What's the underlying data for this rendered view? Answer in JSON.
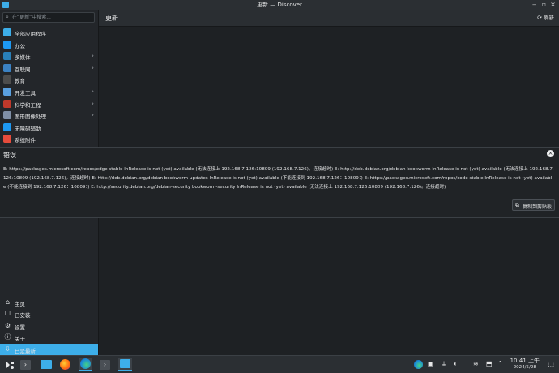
{
  "window": {
    "title": "更新 — Discover"
  },
  "search": {
    "placeholder": "在“更新”中搜索..."
  },
  "categories": [
    {
      "label": "全部应用程序",
      "icon": "all-apps-icon",
      "color": "#3daee9",
      "expandable": false
    },
    {
      "label": "办公",
      "icon": "office-icon",
      "color": "#1d99f3",
      "expandable": false
    },
    {
      "label": "多媒体",
      "icon": "multimedia-icon",
      "color": "#2980b9",
      "expandable": true
    },
    {
      "label": "互联网",
      "icon": "internet-icon",
      "color": "#3b82c4",
      "expandable": true
    },
    {
      "label": "教育",
      "icon": "education-icon",
      "color": "#4d4d4d",
      "expandable": false
    },
    {
      "label": "开发工具",
      "icon": "dev-tools-icon",
      "color": "#5aa0e0",
      "expandable": true
    },
    {
      "label": "科学和工程",
      "icon": "science-icon",
      "color": "#c0392b",
      "expandable": true
    },
    {
      "label": "图形图像处理",
      "icon": "graphics-icon",
      "color": "#7f8fa6",
      "expandable": true
    },
    {
      "label": "无障碍辅助",
      "icon": "accessibility-icon",
      "color": "#1d99f3",
      "expandable": false
    },
    {
      "label": "系统附件",
      "icon": "system-accessories-icon",
      "color": "#e74c3c",
      "expandable": false
    }
  ],
  "bottom_nav": [
    {
      "label": "主页",
      "icon": "home-icon",
      "glyph": "⌂",
      "active": false
    },
    {
      "label": "已安装",
      "icon": "installed-icon",
      "glyph": "☐",
      "active": false
    },
    {
      "label": "设置",
      "icon": "settings-icon",
      "glyph": "⚙",
      "active": false
    },
    {
      "label": "关于",
      "icon": "about-icon",
      "glyph": "ⓘ",
      "active": false
    },
    {
      "label": "已是最新",
      "icon": "up-to-date-icon",
      "glyph": "⇩",
      "active": true
    }
  ],
  "header": {
    "title": "更新",
    "refresh_label": "刷新"
  },
  "error": {
    "title": "错误",
    "message": "E: https://packages.microsoft.com/repos/edge stable InRelease is not (yet) available (无法连接上 192.168.7.126:10809 (192.168.7.126)。连接超时) E: http://deb.debian.org/debian bookworm InRelease is not (yet) available (无法连接上 192.168.7.126:10809 (192.168.7.126)。连接超时) E: http://deb.debian.org/debian bookworm-updates InRelease is not (yet) available (不能连接到 192.168.7.126：10809：) E: https://packages.microsoft.com/repos/code stable InRelease is not (yet) available (不能连接到 192.168.7.126：10809：) E: http://security.debian.org/debian-security bookworm-security InRelease is not (yet) available (无法连接上 192.168.7.126:10809 (192.168.7.126)。连接超时)",
    "copy_label": "复制到剪贴板"
  },
  "taskbar": {
    "time": "10:41 上午",
    "date": "2024/5/28"
  },
  "colors": {
    "accent": "#3daee9",
    "window_bg": "#202326"
  }
}
